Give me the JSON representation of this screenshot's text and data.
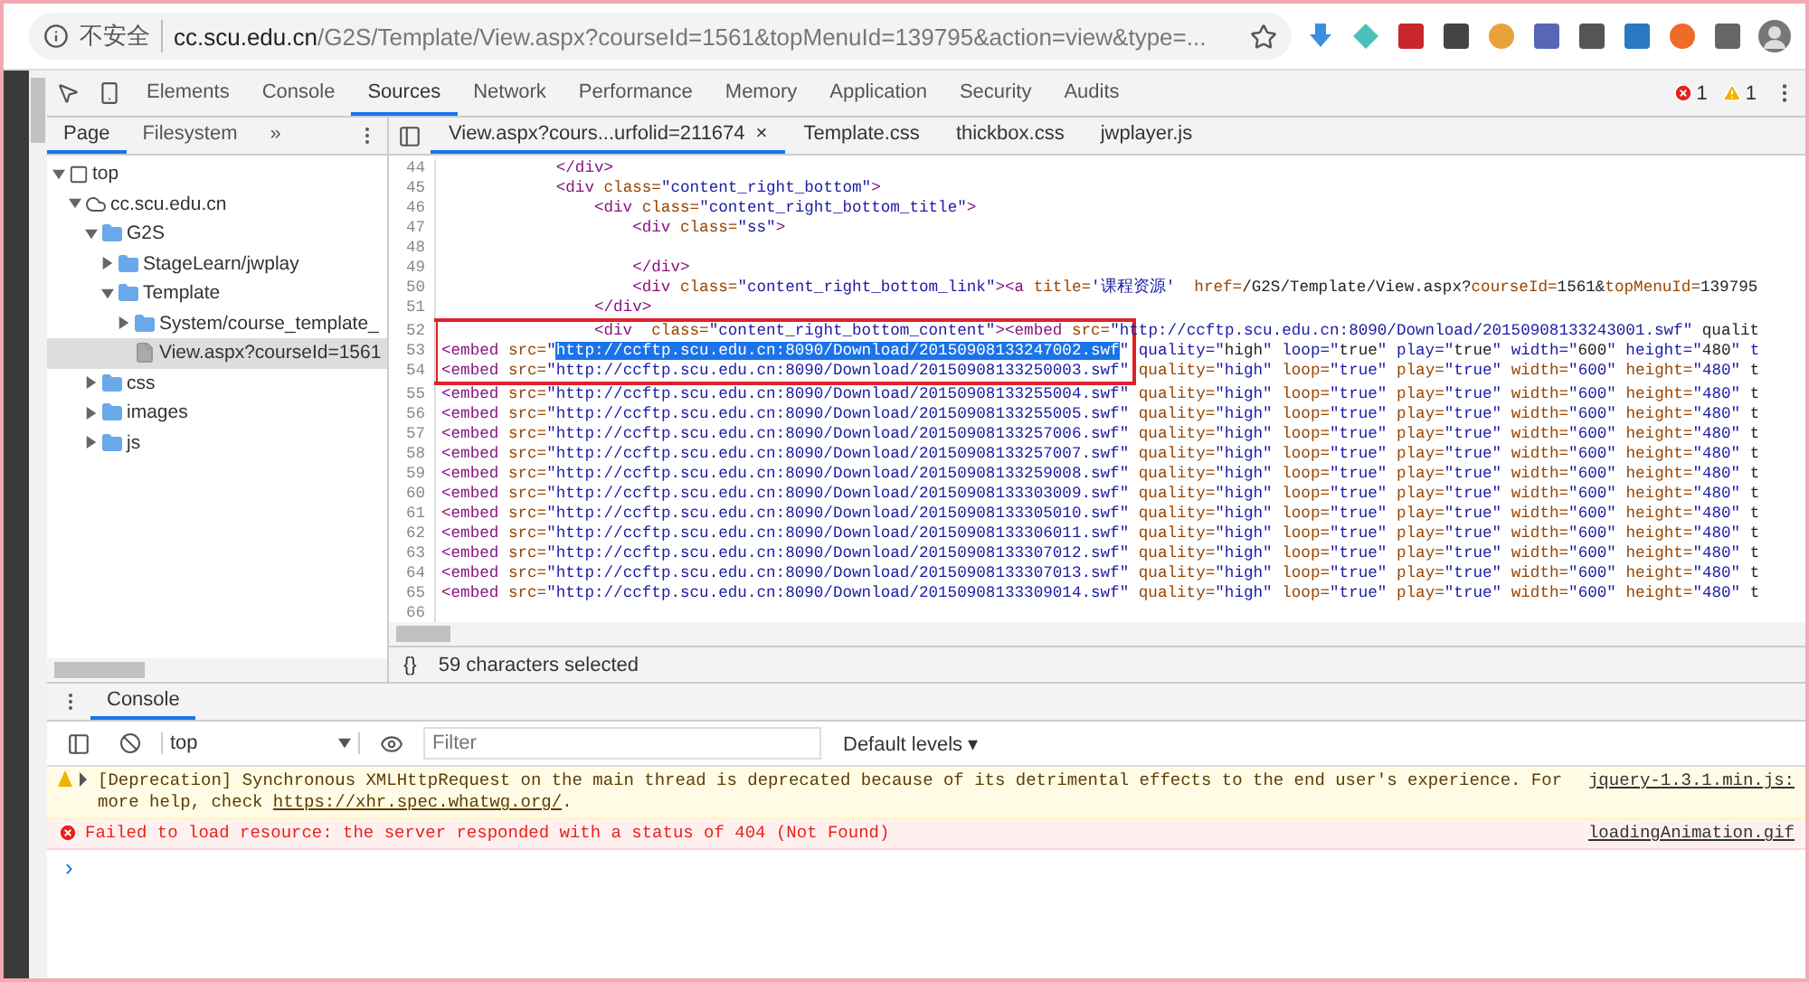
{
  "browser": {
    "security_label": "不安全",
    "url_host": "cc.scu.edu.cn",
    "url_path": "/G2S/Template/View.aspx?courseId=1561&topMenuId=139795&action=view&type=..."
  },
  "devtools": {
    "tabs": [
      {
        "label": "Elements",
        "selected": false
      },
      {
        "label": "Console",
        "selected": false
      },
      {
        "label": "Sources",
        "selected": true
      },
      {
        "label": "Network",
        "selected": false
      },
      {
        "label": "Performance",
        "selected": false
      },
      {
        "label": "Memory",
        "selected": false
      },
      {
        "label": "Application",
        "selected": false
      },
      {
        "label": "Security",
        "selected": false
      },
      {
        "label": "Audits",
        "selected": false
      }
    ],
    "error_count": "1",
    "warning_count": "1"
  },
  "navigator": {
    "tabs": [
      {
        "label": "Page",
        "selected": true
      },
      {
        "label": "Filesystem",
        "selected": false
      }
    ],
    "more": "»",
    "tree": [
      {
        "kind": "frame",
        "label": "top",
        "expanded": true,
        "selected": false,
        "children": [
          {
            "kind": "domain",
            "label": "cc.scu.edu.cn",
            "expanded": true,
            "selected": false,
            "children": [
              {
                "kind": "folder",
                "label": "G2S",
                "expanded": true,
                "selected": false,
                "children": [
                  {
                    "kind": "folder",
                    "label": "StageLearn/jwplay",
                    "expanded": false,
                    "selected": false
                  },
                  {
                    "kind": "folder",
                    "label": "Template",
                    "expanded": true,
                    "selected": false,
                    "children": [
                      {
                        "kind": "folder",
                        "label": "System/course_template_",
                        "expanded": false,
                        "selected": false
                      },
                      {
                        "kind": "file",
                        "label": "View.aspx?courseId=1561",
                        "selected": true
                      }
                    ]
                  }
                ]
              },
              {
                "kind": "folder",
                "label": "css",
                "expanded": false,
                "selected": false
              },
              {
                "kind": "folder",
                "label": "images",
                "expanded": false,
                "selected": false
              },
              {
                "kind": "folder",
                "label": "js",
                "expanded": false,
                "selected": false
              }
            ]
          }
        ]
      }
    ]
  },
  "editor": {
    "tabs": [
      {
        "label": "View.aspx?cours...urfolid=211674",
        "selected": true,
        "close": "×"
      },
      {
        "label": "Template.css",
        "selected": false
      },
      {
        "label": "thickbox.css",
        "selected": false
      },
      {
        "label": "jwplayer.js",
        "selected": false
      }
    ],
    "lines": [
      {
        "number": "44",
        "parts": [
          {
            "text": "            </div>",
            "selected": false
          }
        ]
      },
      {
        "number": "45",
        "parts": [
          {
            "text": "            <div class=\"content_right_bottom\">",
            "selected": false
          }
        ]
      },
      {
        "number": "46",
        "parts": [
          {
            "text": "                <div class=\"content_right_bottom_title\">",
            "selected": false
          }
        ]
      },
      {
        "number": "47",
        "parts": [
          {
            "text": "                    <div class=\"ss\">",
            "selected": false
          }
        ]
      },
      {
        "number": "48"
      },
      {
        "number": "49",
        "parts": [
          {
            "text": "                    </div>",
            "selected": false
          }
        ]
      },
      {
        "number": "50",
        "parts": [
          {
            "text": "                    <div class=\"content_right_bottom_link\"><a title='课程资源'  href=/G2S/Template/View.aspx?courseId=1561&topMenuId=139795",
            "selected": false
          }
        ]
      },
      {
        "number": "51",
        "parts": [
          {
            "text": "                </div>",
            "selected": false
          }
        ]
      },
      {
        "number": "52",
        "boxed": true,
        "parts": [
          {
            "text": "                <div  class=\"content_right_bottom_content\"><embed src=\"http://ccftp.scu.edu.cn:8090/Download/20150908133243001.swf\" qualit",
            "selected": false
          }
        ]
      },
      {
        "number": "53",
        "boxed": true,
        "parts": [
          {
            "text": "<embed src=\"",
            "selected": false
          },
          {
            "text": "http://ccftp.scu.edu.cn:8090/Download/20150908133247002.swf",
            "selected": true
          },
          {
            "text": "\" quality=\"high\" loop=\"true\" play=\"true\" width=\"600\" height=\"480\" t",
            "selected": false
          }
        ]
      },
      {
        "number": "54",
        "boxed": true,
        "parts": [
          {
            "text": "<embed src=\"http://ccftp.scu.edu.cn:8090/Download/20150908133250003.swf\" quality=\"high\" loop=\"true\" play=\"true\" width=\"600\" height=\"480\" t",
            "selected": false
          }
        ]
      },
      {
        "number": "55",
        "parts": [
          {
            "text": "<embed src=\"http://ccftp.scu.edu.cn:8090/Download/20150908133255004.swf\" quality=\"high\" loop=\"true\" play=\"true\" width=\"600\" height=\"480\" t",
            "selected": false
          }
        ]
      },
      {
        "number": "56",
        "parts": [
          {
            "text": "<embed src=\"http://ccftp.scu.edu.cn:8090/Download/20150908133255005.swf\" quality=\"high\" loop=\"true\" play=\"true\" width=\"600\" height=\"480\" t",
            "selected": false
          }
        ]
      },
      {
        "number": "57",
        "parts": [
          {
            "text": "<embed src=\"http://ccftp.scu.edu.cn:8090/Download/20150908133257006.swf\" quality=\"high\" loop=\"true\" play=\"true\" width=\"600\" height=\"480\" t",
            "selected": false
          }
        ]
      },
      {
        "number": "58",
        "parts": [
          {
            "text": "<embed src=\"http://ccftp.scu.edu.cn:8090/Download/20150908133257007.swf\" quality=\"high\" loop=\"true\" play=\"true\" width=\"600\" height=\"480\" t",
            "selected": false
          }
        ]
      },
      {
        "number": "59",
        "parts": [
          {
            "text": "<embed src=\"http://ccftp.scu.edu.cn:8090/Download/20150908133259008.swf\" quality=\"high\" loop=\"true\" play=\"true\" width=\"600\" height=\"480\" t",
            "selected": false
          }
        ]
      },
      {
        "number": "60",
        "parts": [
          {
            "text": "<embed src=\"http://ccftp.scu.edu.cn:8090/Download/20150908133303009.swf\" quality=\"high\" loop=\"true\" play=\"true\" width=\"600\" height=\"480\" t",
            "selected": false
          }
        ]
      },
      {
        "number": "61",
        "parts": [
          {
            "text": "<embed src=\"http://ccftp.scu.edu.cn:8090/Download/20150908133305010.swf\" quality=\"high\" loop=\"true\" play=\"true\" width=\"600\" height=\"480\" t",
            "selected": false
          }
        ]
      },
      {
        "number": "62",
        "parts": [
          {
            "text": "<embed src=\"http://ccftp.scu.edu.cn:8090/Download/20150908133306011.swf\" quality=\"high\" loop=\"true\" play=\"true\" width=\"600\" height=\"480\" t",
            "selected": false
          }
        ]
      },
      {
        "number": "63",
        "parts": [
          {
            "text": "<embed src=\"http://ccftp.scu.edu.cn:8090/Download/20150908133307012.swf\" quality=\"high\" loop=\"true\" play=\"true\" width=\"600\" height=\"480\" t",
            "selected": false
          }
        ]
      },
      {
        "number": "64",
        "parts": [
          {
            "text": "<embed src=\"http://ccftp.scu.edu.cn:8090/Download/20150908133307013.swf\" quality=\"high\" loop=\"true\" play=\"true\" width=\"600\" height=\"480\" t",
            "selected": false
          }
        ]
      },
      {
        "number": "65",
        "parts": [
          {
            "text": "<embed src=\"http://ccftp.scu.edu.cn:8090/Download/20150908133309014.swf\" quality=\"high\" loop=\"true\" play=\"true\" width=\"600\" height=\"480\" t",
            "selected": false
          }
        ]
      },
      {
        "number": "66"
      }
    ],
    "status": {
      "braces": "{}",
      "text": "59 characters selected"
    }
  },
  "console": {
    "drawer_tab": "Console",
    "context": "top",
    "filter_placeholder": "Filter",
    "levels": "Default levels",
    "levels_caret": "▾",
    "messages": [
      {
        "kind": "warning",
        "before": "[Deprecation] Synchronous XMLHttpRequest on the main thread is deprecated because of its detrimental effects to the end user's experience. For more help, check ",
        "link": "https://xhr.spec.whatwg.org/",
        "after": ".",
        "source": "jquery-1.3.1.min.js:"
      },
      {
        "kind": "error",
        "before": "Failed to load resource: the server responded with a status of 404 (Not Found)",
        "source": "loadingAnimation.gif"
      }
    ],
    "prompt": "›"
  }
}
